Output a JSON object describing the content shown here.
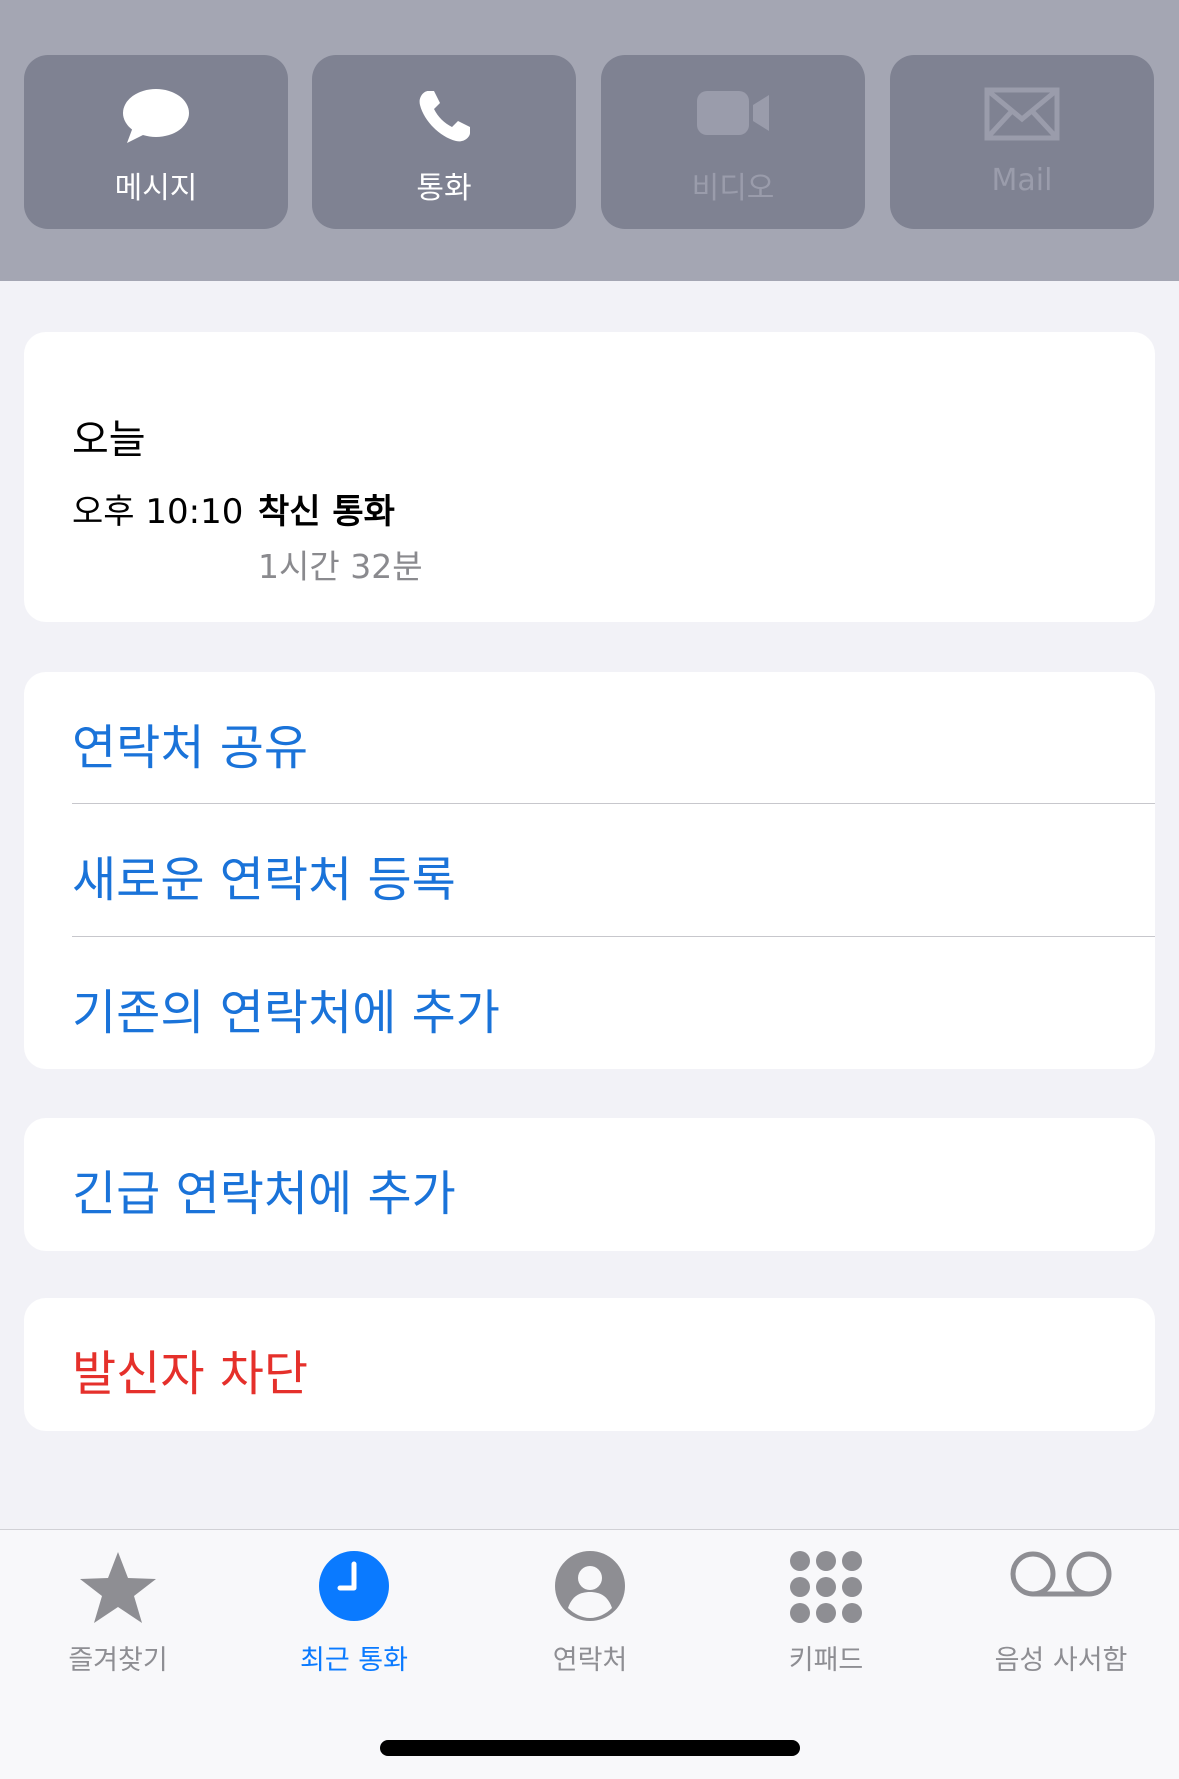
{
  "actions": [
    {
      "label": "메시지",
      "icon": "message-icon",
      "enabled": true
    },
    {
      "label": "통화",
      "icon": "phone-icon",
      "enabled": true
    },
    {
      "label": "비디오",
      "icon": "video-icon",
      "enabled": false
    },
    {
      "label": "Mail",
      "icon": "mail-icon",
      "enabled": false
    }
  ],
  "call_log": {
    "date": "오늘",
    "time": "오후 10:10",
    "type": "착신 통화",
    "duration": "1시간 32분"
  },
  "contact_options": [
    {
      "label": "연락처 공유"
    },
    {
      "label": "새로운 연락처 등록"
    },
    {
      "label": "기존의 연락처에 추가"
    }
  ],
  "emergency": {
    "label": "긴급 연락처에 추가"
  },
  "block": {
    "label": "발신자 차단"
  },
  "tabs": [
    {
      "label": "즐겨찾기",
      "icon": "star-icon",
      "active": false
    },
    {
      "label": "최근 통화",
      "icon": "clock-icon",
      "active": true
    },
    {
      "label": "연락처",
      "icon": "person-icon",
      "active": false
    },
    {
      "label": "키패드",
      "icon": "keypad-icon",
      "active": false
    },
    {
      "label": "음성 사서함",
      "icon": "voicemail-icon",
      "active": false
    }
  ],
  "colors": {
    "accent": "#0a7aff",
    "link": "#1a73d9",
    "destructive": "#e5302b",
    "header_bg": "#a4a6b3",
    "action_bg": "#7f8292"
  }
}
